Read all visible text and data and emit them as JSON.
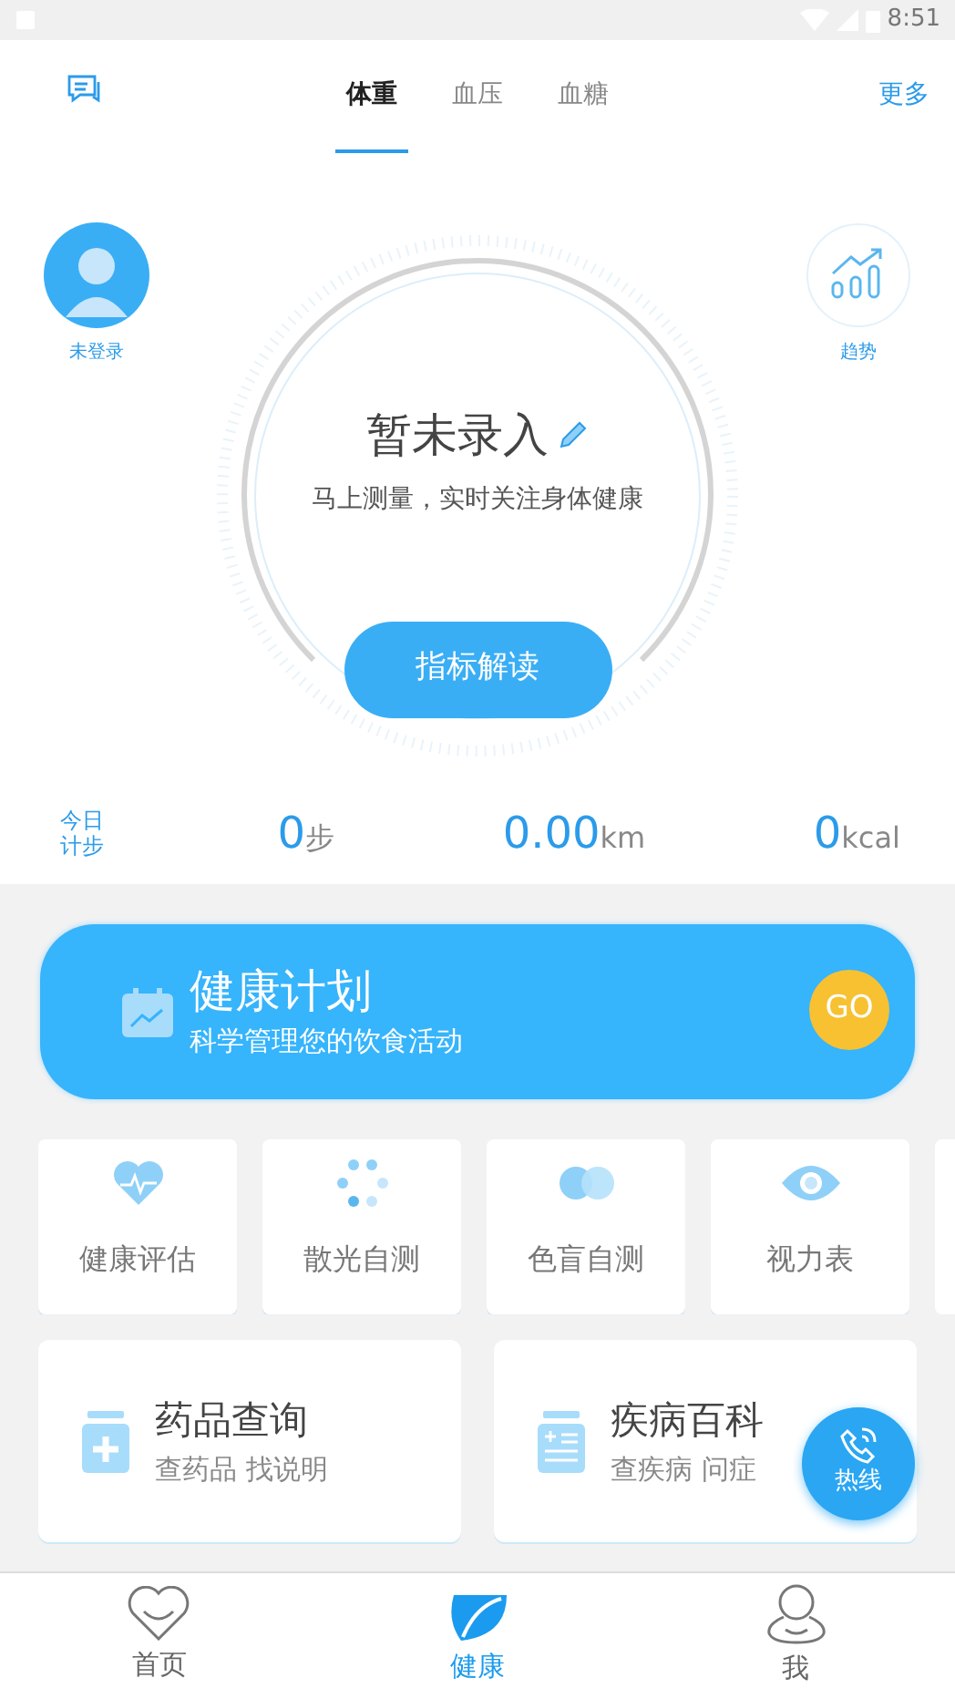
{
  "status_bar": {
    "time": "8:51"
  },
  "header": {
    "more": "更多",
    "tabs": [
      {
        "label": "体重",
        "selected": true
      },
      {
        "label": "血压",
        "selected": false
      },
      {
        "label": "血糖",
        "selected": false
      }
    ]
  },
  "profile": {
    "label": "未登录"
  },
  "trend": {
    "label": "趋势"
  },
  "gauge": {
    "title": "暂未录入",
    "subtitle": "马上测量，实时关注身体健康",
    "button": "指标解读"
  },
  "steps": {
    "label": "今日计步",
    "stats": [
      {
        "value": "0",
        "unit": "步"
      },
      {
        "value": "0.00",
        "unit": "km"
      },
      {
        "value": "0",
        "unit": "kcal"
      }
    ]
  },
  "plan": {
    "title": "健康计划",
    "subtitle": "科学管理您的饮食活动",
    "go": "GO"
  },
  "tools": [
    {
      "kind": "heart",
      "label": "健康评估"
    },
    {
      "kind": "dots",
      "label": "散光自测"
    },
    {
      "kind": "circles",
      "label": "色盲自测"
    },
    {
      "kind": "eye",
      "label": "视力表"
    }
  ],
  "cards": [
    {
      "kind": "medicine",
      "title": "药品查询",
      "subtitle": "查药品 找说明"
    },
    {
      "kind": "disease",
      "title": "疾病百科",
      "subtitle": "查疾病 问症"
    }
  ],
  "hotline": {
    "label": "热线"
  },
  "nav": [
    {
      "kind": "home",
      "label": "首页",
      "selected": false
    },
    {
      "kind": "leaf",
      "label": "健康",
      "selected": true
    },
    {
      "kind": "person",
      "label": "我",
      "selected": false
    }
  ]
}
